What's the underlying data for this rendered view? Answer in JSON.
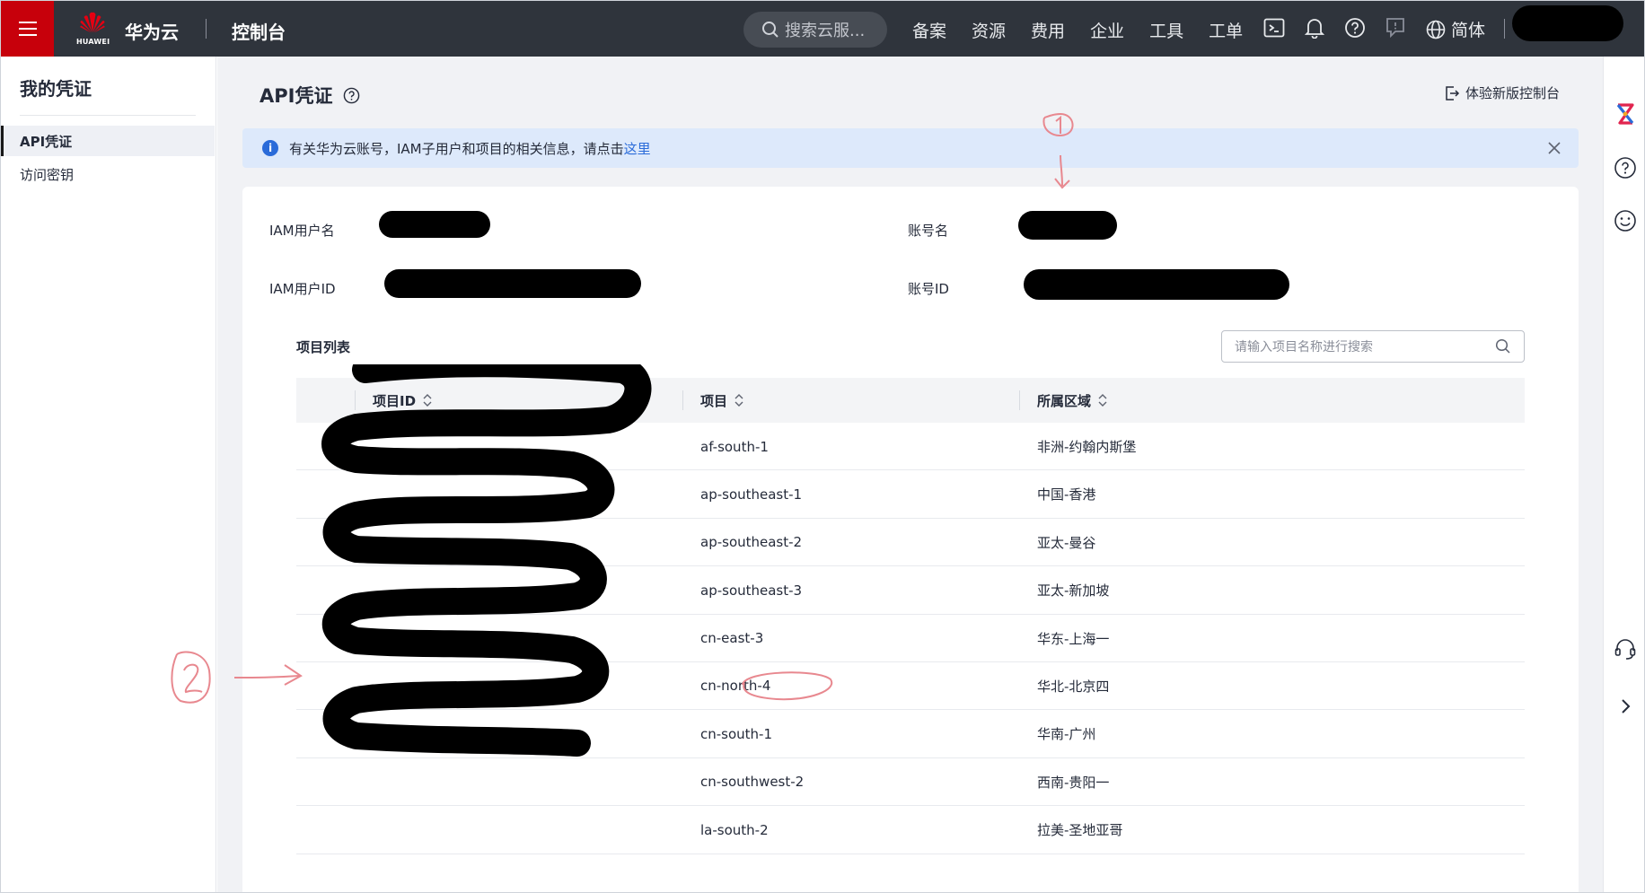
{
  "topbar": {
    "logo_text": "HUAWEI",
    "brand": "华为云",
    "console": "控制台",
    "search_placeholder": "搜索云服...",
    "nav": [
      "备案",
      "资源",
      "费用",
      "企业",
      "工具",
      "工单"
    ],
    "language": "简体",
    "icons": [
      "terminal-icon",
      "bell-icon",
      "help-icon",
      "feedback-icon",
      "globe-icon"
    ]
  },
  "sidebar": {
    "title": "我的凭证",
    "items": [
      {
        "label": "API凭证",
        "active": true
      },
      {
        "label": "访问密钥",
        "active": false
      }
    ]
  },
  "page": {
    "title": "API凭证",
    "new_console": "体验新版控制台",
    "notice_text": "有关华为云账号，IAM子用户和项目的相关信息，请点击",
    "notice_link": "这里"
  },
  "info": {
    "iam_user_label": "IAM用户名",
    "account_label": "账号名",
    "iam_user_id_label": "IAM用户ID",
    "account_id_label": "账号ID"
  },
  "projects": {
    "title": "项目列表",
    "search_placeholder": "请输入项目名称进行搜索",
    "columns": [
      "项目ID",
      "项目",
      "所属区域"
    ],
    "rows": [
      {
        "project": "af-south-1",
        "region": "非洲-约翰内斯堡"
      },
      {
        "project": "ap-southeast-1",
        "region": "中国-香港"
      },
      {
        "project": "ap-southeast-2",
        "region": "亚太-曼谷"
      },
      {
        "project": "ap-southeast-3",
        "region": "亚太-新加坡"
      },
      {
        "project": "cn-east-3",
        "region": "华东-上海一"
      },
      {
        "project": "cn-north-4",
        "region": "华北-北京四"
      },
      {
        "project": "cn-south-1",
        "region": "华南-广州"
      },
      {
        "project": "cn-southwest-2",
        "region": "西南-贵阳一"
      },
      {
        "project": "la-south-2",
        "region": "拉美-圣地亚哥"
      }
    ]
  },
  "colors": {
    "accent_red": "#c7000b",
    "topbar_bg": "#2f343c",
    "link_blue": "#2a6bd9",
    "annotation_red": "#e8888f"
  }
}
